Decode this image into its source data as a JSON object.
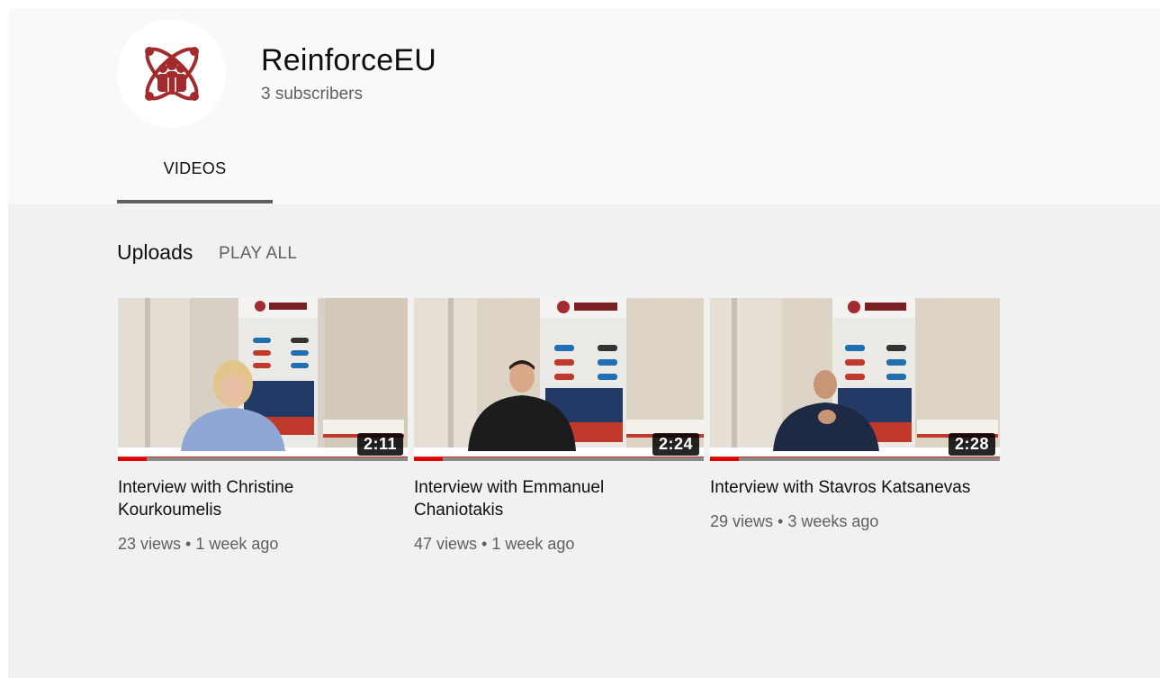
{
  "channel": {
    "name": "ReinforceEU",
    "subscribers": "3 subscribers",
    "logo_color": "#a22b2e"
  },
  "tabs": [
    {
      "label": "VIDEOS",
      "selected": true
    }
  ],
  "shelf": {
    "title": "Uploads",
    "play_all": "PLAY ALL"
  },
  "videos": [
    {
      "title": "Interview with Christine Kourkoumelis",
      "duration": "2:11",
      "views": "23 views",
      "separator": "•",
      "age": "1 week ago",
      "watched_fraction": 0.1
    },
    {
      "title": "Interview with Emmanuel Chaniotakis",
      "duration": "2:24",
      "views": "47 views",
      "separator": "•",
      "age": "1 week ago",
      "watched_fraction": 0.1
    },
    {
      "title": "Interview with Stavros Katsanevas",
      "duration": "2:28",
      "views": "29 views",
      "separator": "•",
      "age": "3 weeks ago",
      "watched_fraction": 0.1
    }
  ]
}
